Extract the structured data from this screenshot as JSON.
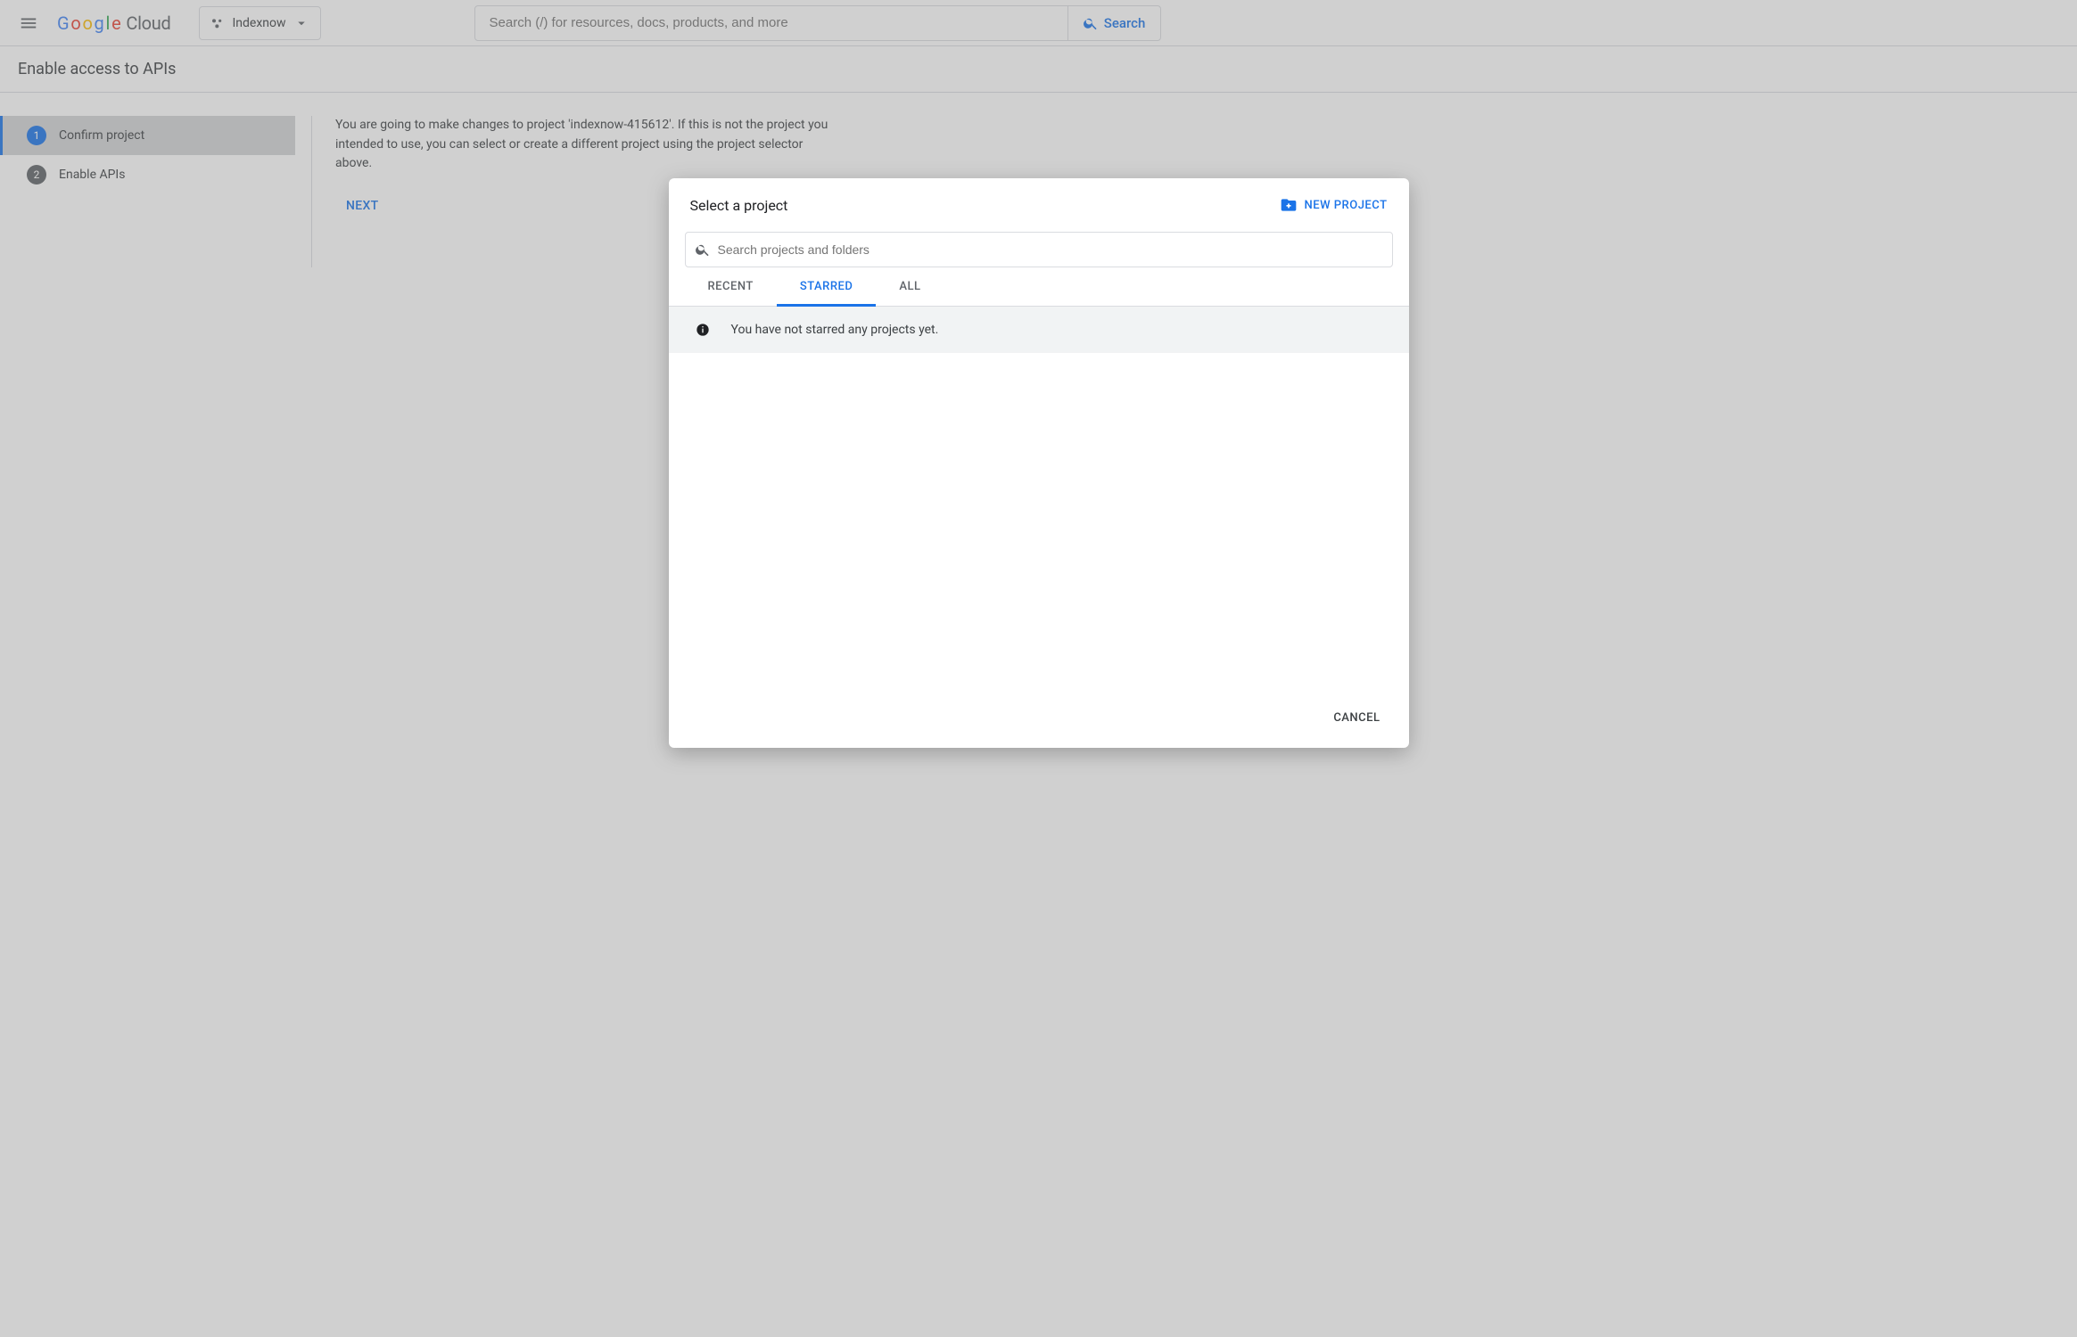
{
  "header": {
    "product_name": "Cloud",
    "project_dropdown_label": "Indexnow",
    "search_placeholder": "Search (/) for resources, docs, products, and more",
    "search_button_label": "Search"
  },
  "subheader": {
    "title": "Enable access to APIs"
  },
  "steps": {
    "active_index": 0,
    "items": [
      {
        "num": "1",
        "label": "Confirm project"
      },
      {
        "num": "2",
        "label": "Enable APIs"
      }
    ]
  },
  "content": {
    "body_text": "You are going to make changes to project 'indexnow-415612'. If this is not the project you intended to use, you can select or create a different project using the project selector above.",
    "next_label": "NEXT"
  },
  "modal": {
    "title": "Select a project",
    "new_project_label": "NEW PROJECT",
    "search_placeholder": "Search projects and folders",
    "tabs": {
      "recent": "RECENT",
      "starred": "STARRED",
      "all": "ALL",
      "active": "starred"
    },
    "empty_message": "You have not starred any projects yet.",
    "cancel_label": "CANCEL"
  }
}
